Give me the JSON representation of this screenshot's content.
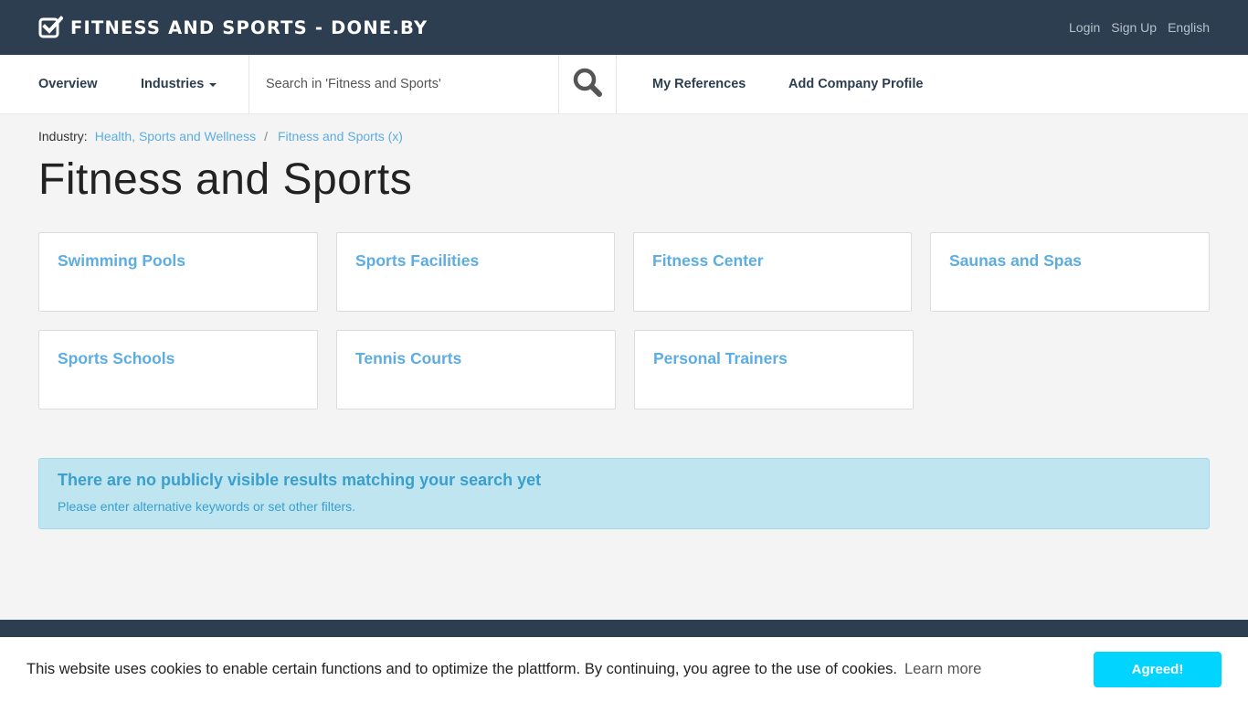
{
  "header": {
    "brand_title": "Fitness and Sports - Done.by",
    "links": [
      "Login",
      "Sign Up",
      "English"
    ]
  },
  "nav": {
    "overview": "Overview",
    "industries": "Industries",
    "search_placeholder": "Search in 'Fitness and Sports'",
    "my_references": "My References",
    "add_company_profile": "Add Company Profile"
  },
  "breadcrumb": {
    "label": "Industry:",
    "parent": "Health, Sports and Wellness",
    "separator": "/",
    "current": "Fitness and Sports (x)"
  },
  "page_title": "Fitness and Sports",
  "categories": [
    "Swimming Pools",
    "Sports Facilities",
    "Fitness Center",
    "Saunas and Spas",
    "Sports Schools",
    "Tennis Courts",
    "Personal Trainers"
  ],
  "alert": {
    "title": "There are no publicly visible results matching your search yet",
    "text": "Please enter alternative keywords or set other filters."
  },
  "cookie": {
    "message": "This website uses cookies to enable certain functions and to optimize the plattform. By continuing, you agree to the use of cookies.",
    "learn_more": "Learn more",
    "button": "Agreed!"
  },
  "colors": {
    "header_bg": "#2c3e50",
    "link": "#5dade2",
    "alert_bg": "#bee5f0",
    "cookie_button": "#00d4ff"
  }
}
